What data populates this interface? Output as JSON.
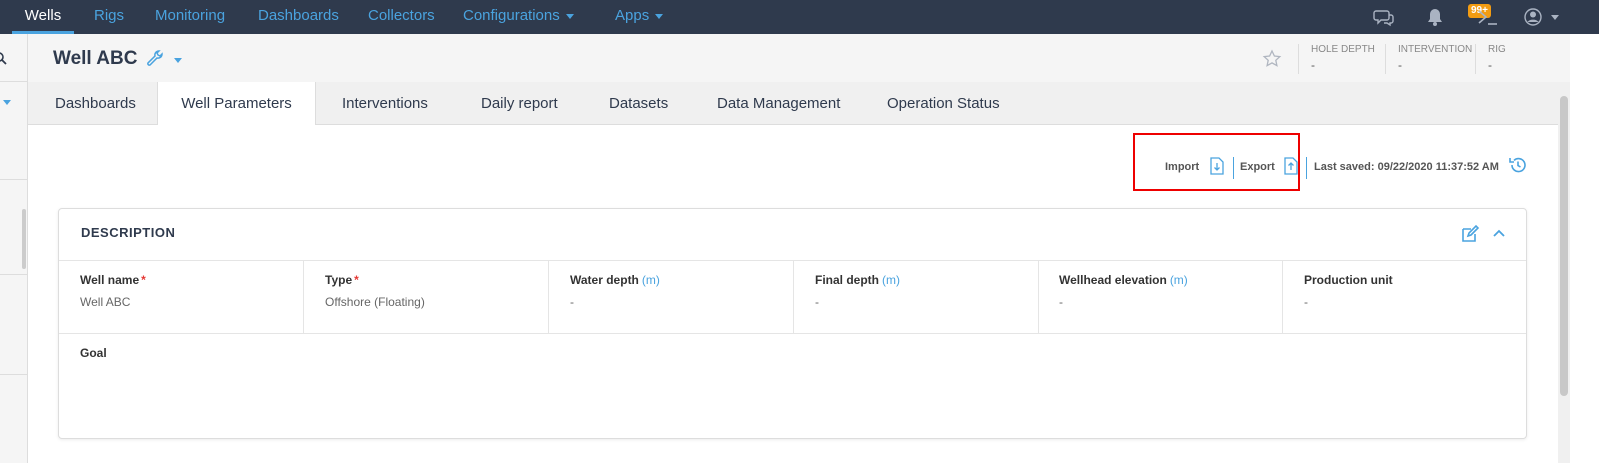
{
  "nav": {
    "items": [
      "Wells",
      "Rigs",
      "Monitoring",
      "Dashboards",
      "Collectors",
      "Configurations",
      "Apps"
    ],
    "notifications_badge": "99+",
    "accent": "#4aa3df",
    "bg": "#2f3a4d"
  },
  "header": {
    "title": "Well ABC",
    "kpis": [
      {
        "label": "HOLE DEPTH",
        "value": "-"
      },
      {
        "label": "INTERVENTION",
        "value": "-"
      },
      {
        "label": "RIG",
        "value": "-"
      }
    ]
  },
  "tabs": [
    "Dashboards",
    "Well Parameters",
    "Interventions",
    "Daily report",
    "Datasets",
    "Data Management",
    "Operation Status"
  ],
  "active_tab": "Well Parameters",
  "toolbar": {
    "import_label": "Import",
    "export_label": "Export",
    "last_saved_label": "Last saved:",
    "last_saved_value": "09/22/2020 11:37:52 AM"
  },
  "description": {
    "title": "DESCRIPTION",
    "fields": [
      {
        "label": "Well name",
        "required": "*",
        "unit": "",
        "value": "Well ABC"
      },
      {
        "label": "Type",
        "required": "*",
        "unit": "",
        "value": "Offshore (Floating)"
      },
      {
        "label": "Water depth",
        "required": "",
        "unit": "(m)",
        "value": "-"
      },
      {
        "label": "Final depth",
        "required": "",
        "unit": "(m)",
        "value": "-"
      },
      {
        "label": "Wellhead elevation",
        "required": "",
        "unit": "(m)",
        "value": "-"
      },
      {
        "label": "Production unit",
        "required": "",
        "unit": "",
        "value": "-"
      }
    ],
    "goal_label": "Goal"
  }
}
